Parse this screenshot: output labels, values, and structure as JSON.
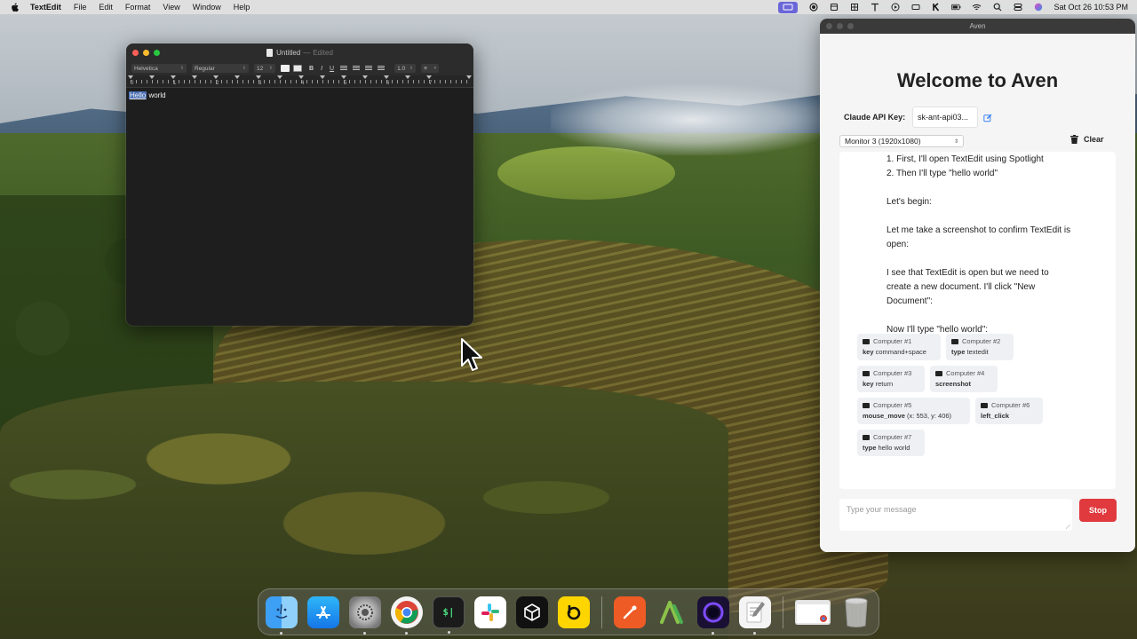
{
  "menubar": {
    "app_name": "TextEdit",
    "items": [
      "File",
      "Edit",
      "Format",
      "View",
      "Window",
      "Help"
    ],
    "clock": "Sat Oct 26  10:53 PM"
  },
  "textedit": {
    "title": "Untitled",
    "separator": "—",
    "status": "Edited",
    "font_family": "Helvetica",
    "font_style": "Regular",
    "font_size": "12",
    "line_spacing": "1.0",
    "ruler_numbers": [
      "0",
      "1",
      "2",
      "3",
      "4",
      "5",
      "6",
      "7"
    ],
    "content_selected": "Hello",
    "content_rest": " world"
  },
  "aven": {
    "window_title": "Aven",
    "heading": "Welcome to Aven",
    "api_key_label": "Claude API Key:",
    "api_key_value": "sk-ant-api03...",
    "monitor_select": "Monitor 3 (1920x1080)",
    "clear_label": "Clear",
    "messages": [
      "1. First, I'll open TextEdit using Spotlight",
      "2. Then I'll type \"hello world\"",
      "",
      "Let's begin:",
      "",
      "Let me take a screenshot to confirm TextEdit is open:",
      "",
      "I see that TextEdit is open but we need to create a new document. I'll click \"New Document\":",
      "",
      "Now I'll type \"hello world\":"
    ],
    "tool_calls": [
      {
        "label": "Computer #1",
        "command": "key",
        "args": "command+space"
      },
      {
        "label": "Computer #2",
        "command": "type",
        "args": "textedit"
      },
      {
        "label": "Computer #3",
        "command": "key",
        "args": "return"
      },
      {
        "label": "Computer #4",
        "command": "screenshot",
        "args": ""
      },
      {
        "label": "Computer #5",
        "command": "mouse_move",
        "args": "(x: 553, y: 406)"
      },
      {
        "label": "Computer #6",
        "command": "left_click",
        "args": ""
      },
      {
        "label": "Computer #7",
        "command": "type",
        "args": "hello world"
      }
    ],
    "input_placeholder": "Type your message",
    "stop_label": "Stop",
    "colors": {
      "stop": "#e03a3e",
      "accent": "#3b82f6"
    }
  },
  "dock": {
    "apps": [
      "finder-icon",
      "app-store-icon",
      "system-settings-icon",
      "chrome-icon",
      "terminal-icon",
      "slack-icon",
      "unity-icon",
      "bitwarden-icon",
      "postman-icon",
      "android-studio-icon",
      "tor-icon",
      "textedit-icon",
      "chrome-window-icon",
      "trash-icon"
    ]
  }
}
